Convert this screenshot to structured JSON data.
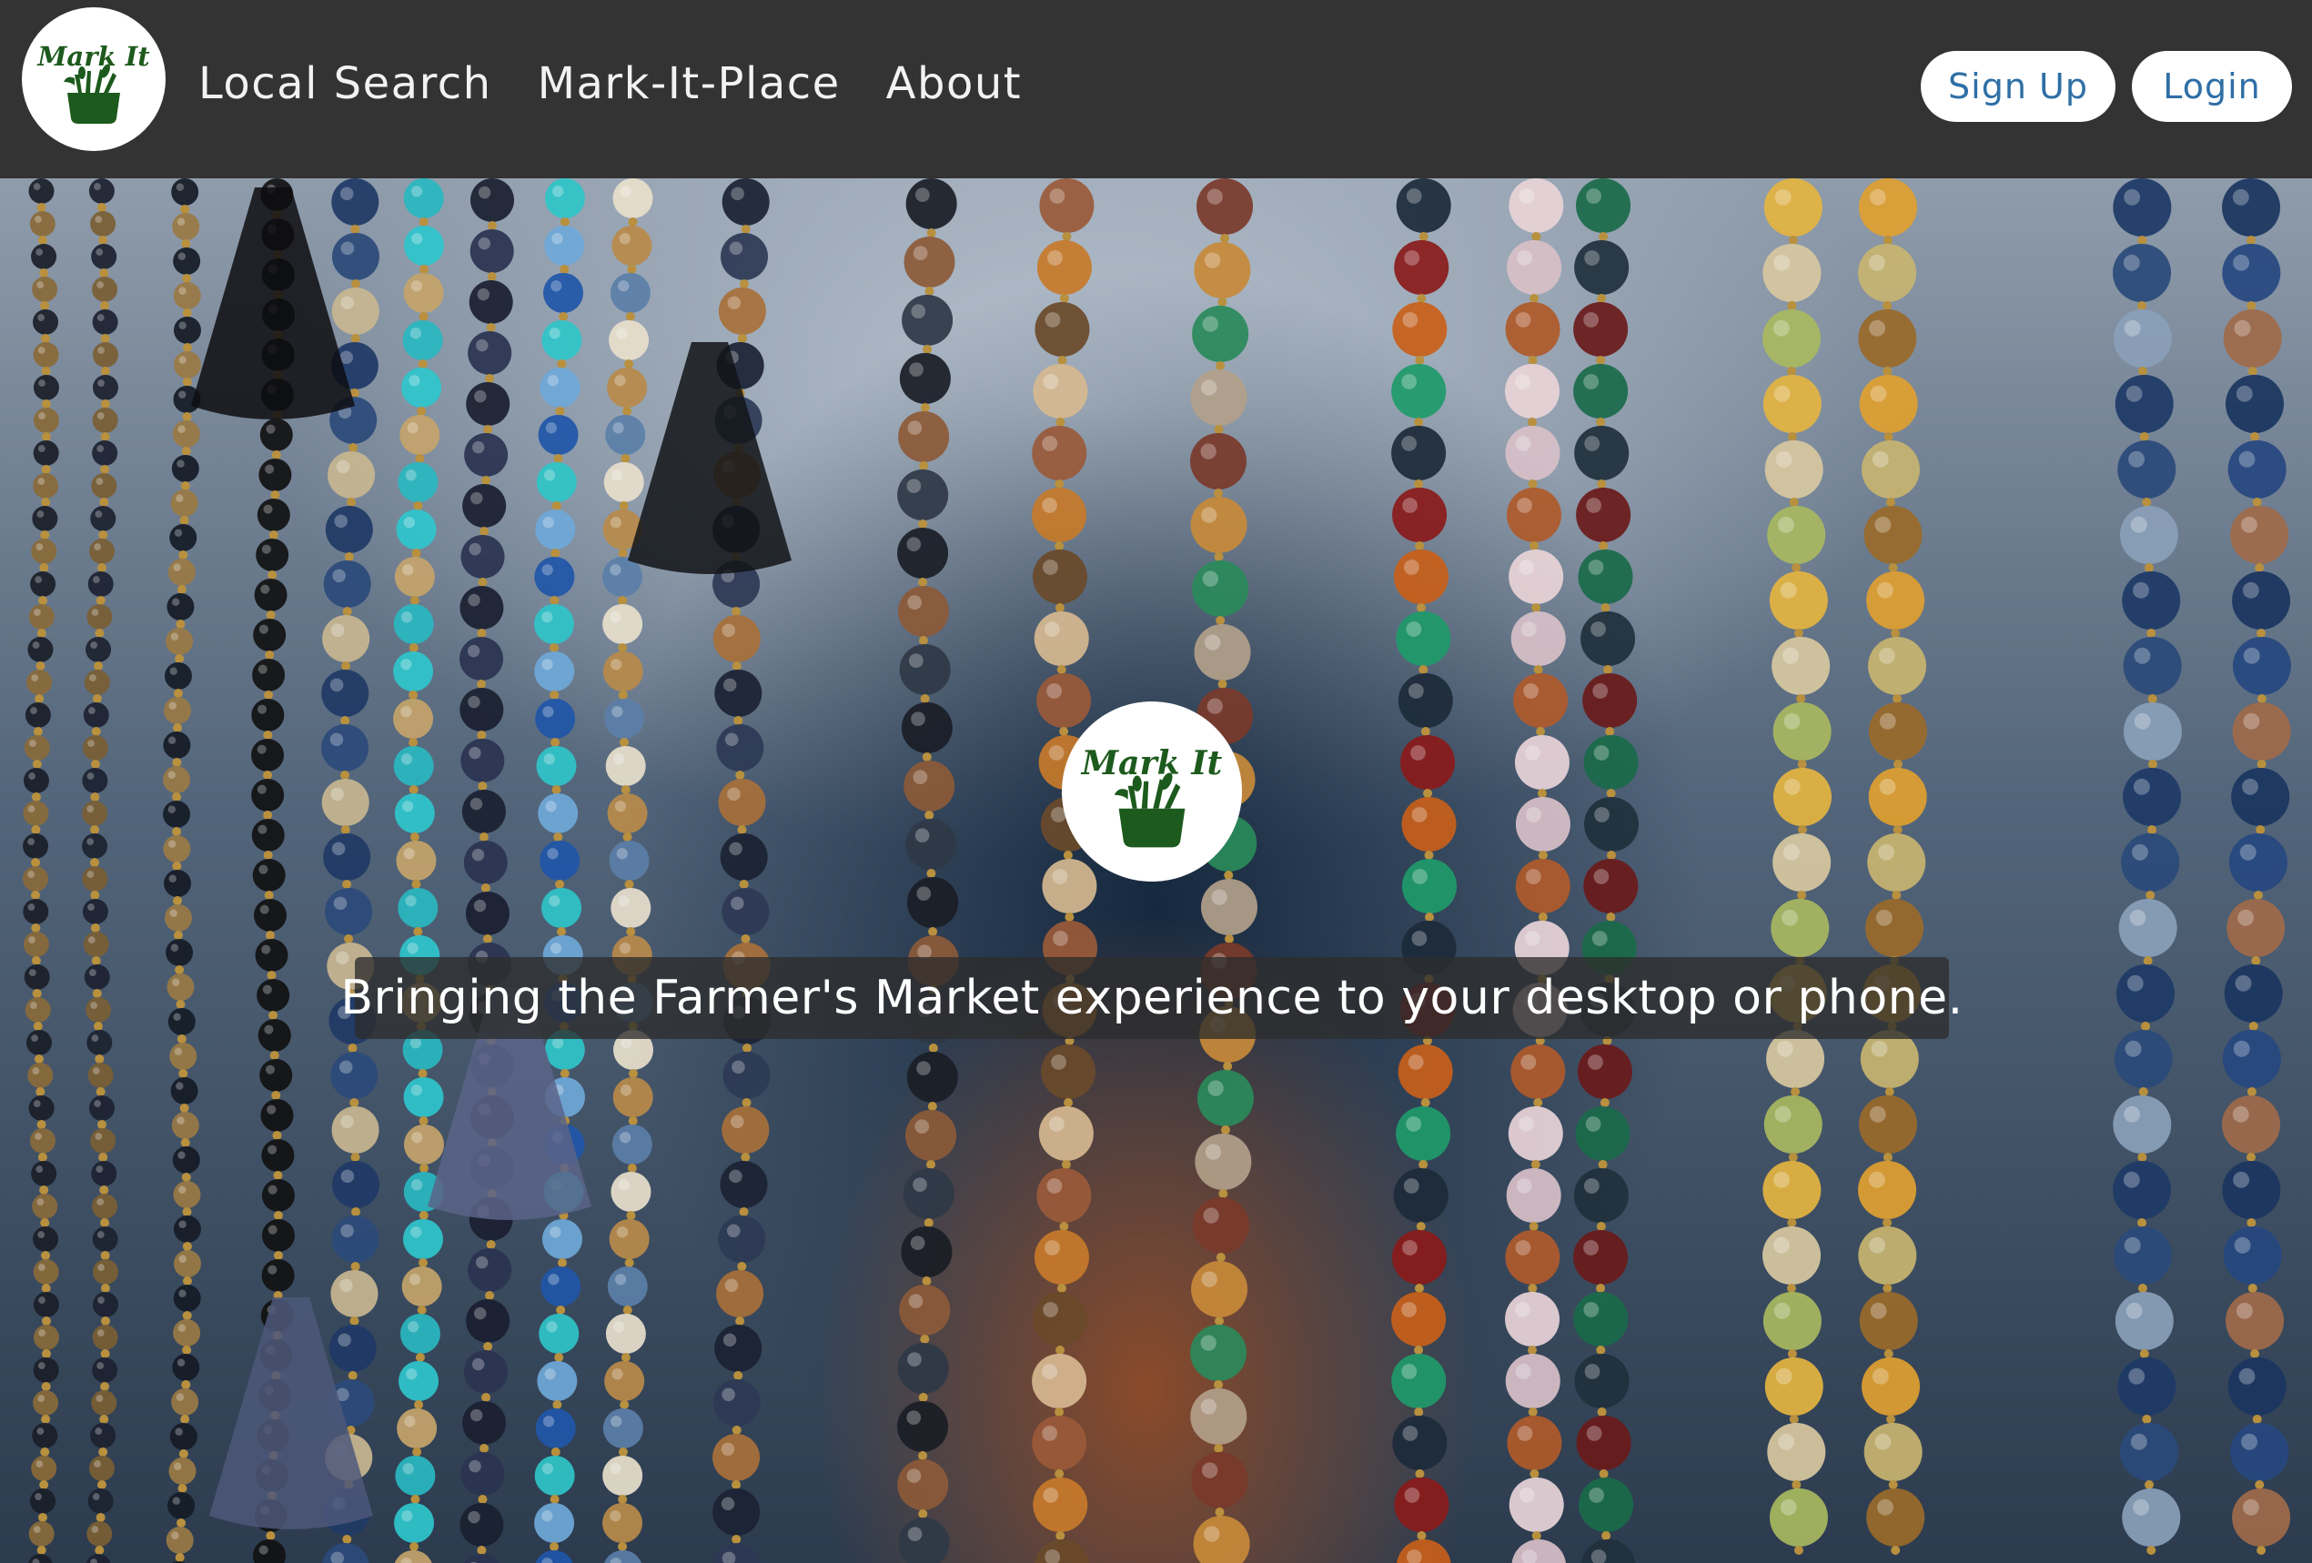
{
  "brand": {
    "logo_text": "Mark It",
    "logo_color": "#1d5a1d"
  },
  "nav": {
    "links": [
      "Local Search",
      "Mark-It-Place",
      "About"
    ],
    "signup_label": "Sign Up",
    "login_label": "Login",
    "background": "#333333",
    "button_text_color": "#2f6fa6"
  },
  "hero": {
    "tagline": "Bringing the Farmer's Market experience to your desktop or phone.",
    "background_image": "hanging-beaded-necklaces-photo"
  }
}
